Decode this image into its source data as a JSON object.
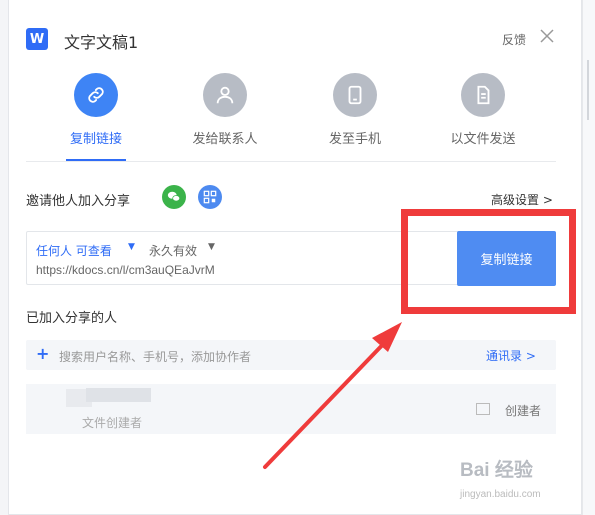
{
  "app": {
    "title": "文字文稿1",
    "feedback": "反馈",
    "app_icon": "W"
  },
  "tabs": [
    {
      "label": "复制链接",
      "icon": "link-icon",
      "active": true
    },
    {
      "label": "发给联系人",
      "icon": "person-icon",
      "active": false
    },
    {
      "label": "发至手机",
      "icon": "phone-icon",
      "active": false
    },
    {
      "label": "以文件发送",
      "icon": "file-icon",
      "active": false
    }
  ],
  "invite": {
    "label": "邀请他人加入分享",
    "advanced": "高级设置 >"
  },
  "link": {
    "permission": "任何人 可查看",
    "expiry": "永久有效",
    "url": "https://kdocs.cn/l/cm3auQEaJvrM",
    "copy_button": "复制链接"
  },
  "members": {
    "label": "已加入分享的人",
    "search_placeholder": "搜索用户名称、手机号，添加协作者",
    "contacts": "通讯录 >",
    "rows": [
      {
        "subtitle": "文件创建者",
        "role": "创建者"
      }
    ]
  },
  "watermark": {
    "brand": "Bai 经验",
    "url": "jingyan.baidu.com"
  },
  "colors": {
    "accent": "#2f6cf6",
    "button": "#4f8cf2",
    "highlight": "#ef3b3b",
    "wechat": "#3bb34a"
  }
}
